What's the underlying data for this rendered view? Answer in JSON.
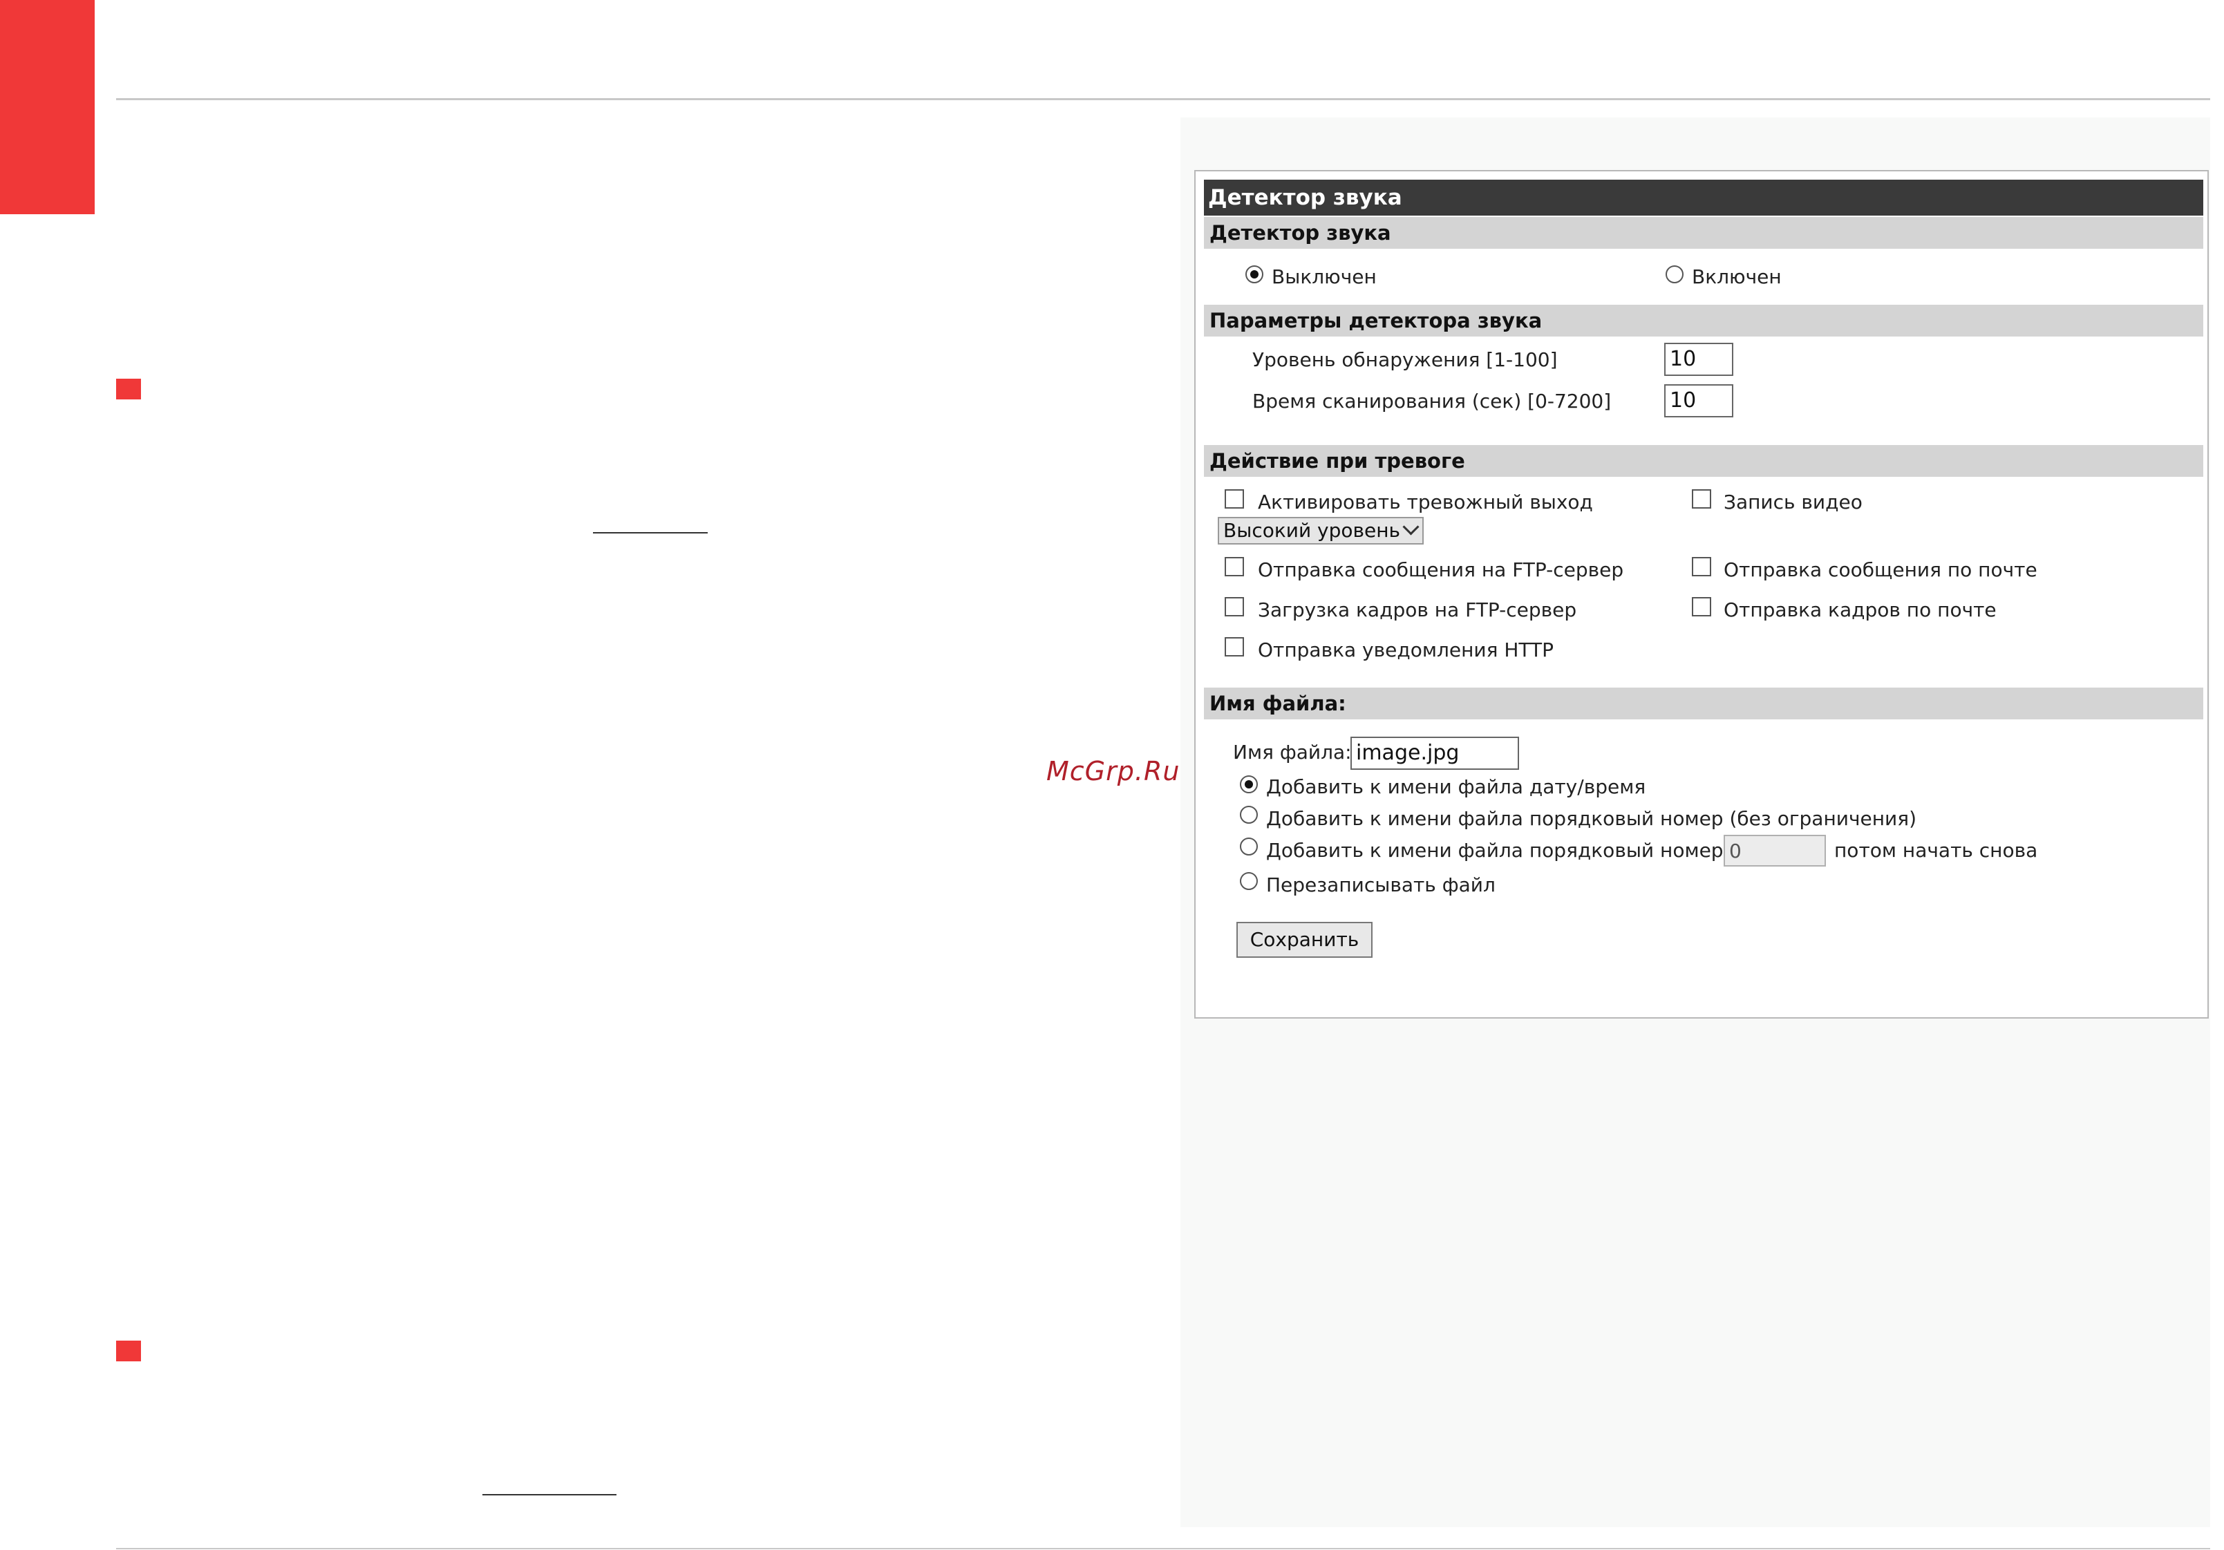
{
  "watermark": "McGrp.Ru",
  "panel": {
    "title": "Детектор звука",
    "detector_section": {
      "header": "Детектор звука",
      "option_off": "Выключен",
      "option_on": "Включен",
      "selected": "off"
    },
    "params_section": {
      "header": "Параметры детектора звука",
      "level_label": "Уровень обнаружения [1-100]",
      "level_value": "10",
      "scan_label": "Время сканирования (сек) [0-7200]",
      "scan_value": "10"
    },
    "alarm_section": {
      "header": "Действие при тревоге",
      "alarm_output": "Активировать тревожный выход",
      "level_select": "Высокий уровень",
      "record_video": "Запись видео",
      "ftp_message": "Отправка сообщения на FTP-сервер",
      "email_message": "Отправка сообщения по почте",
      "ftp_frames": "Загрузка кадров на FTP-сервер",
      "email_frames": "Отправка кадров по почте",
      "http_notify": "Отправка уведомления HTTP"
    },
    "file_section": {
      "header": "Имя файла:",
      "filename_label": "Имя файла:",
      "filename_value": "image.jpg",
      "opt_datetime": "Добавить к имени файла дату/время",
      "opt_sequence": "Добавить к имени файла порядковый номер (без ограничения)",
      "opt_sequence_to": "Добавить к имени файла порядковый номер до",
      "sequence_max": "0",
      "opt_sequence_suffix": "потом начать снова",
      "opt_overwrite": "Перезаписывать файл",
      "selected": "datetime"
    },
    "save_button": "Сохранить"
  }
}
